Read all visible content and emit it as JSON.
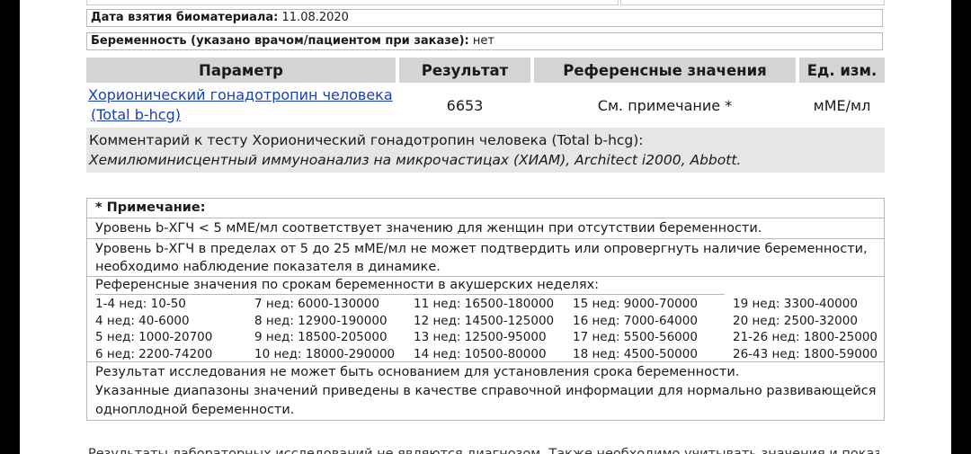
{
  "meta": {
    "sample_date_label": "Дата взятия биоматериала:",
    "sample_date_value": "11.08.2020",
    "pregnancy_label": "Беременность (указано врачом/пациентом при заказе):",
    "pregnancy_value": "нет"
  },
  "results": {
    "headers": [
      "Параметр",
      "Результат",
      "Референсные значения",
      "Ед. изм."
    ],
    "row": {
      "param_line1": "Хорионический гонадотропин человека",
      "param_line2": "(Total b-hcg)",
      "result": "6653",
      "reference": "См. примечание *",
      "unit": "мМЕ/мл"
    },
    "comment_line1": "Комментарий к тесту Хорионический гонадотропин человека (Total b-hcg):",
    "comment_line2": "Хемилюминисцентный иммуноанализ на микрочастицах (ХИАМ), Architect i2000, Abbott."
  },
  "note": {
    "title": "* Примечание:",
    "line1": "Уровень b-ХГЧ < 5 мМЕ/мл соответствует значению для женщин при отсутствии беременности.",
    "line2a": "Уровень b-ХГЧ в пределах от 5 до 25 мМЕ/мл не может подтвердить или опровергнуть наличие беременности,",
    "line2b": "необходимо наблюдение показателя в динамике.",
    "weeks_heading": "Референсные значения по срокам беременности в акушерских неделях:",
    "weeks": [
      "1-4 нед: 10-50",
      "7 нед: 6000-130000",
      "11 нед: 16500-180000",
      "15 нед: 9000-70000",
      "19 нед: 3300-40000",
      "4 нед: 40-6000",
      "8 нед: 12900-190000",
      "12 нед: 14500-125000",
      "16 нед: 7000-64000",
      "20 нед: 2500-32000",
      "5 нед: 1000-20700",
      "9 нед: 18500-205000",
      "13 нед: 12500-95000",
      "17 нед: 5500-56000",
      "21-26 нед: 1800-25000",
      "6 нед: 2200-74200",
      "10 нед: 18000-290000",
      "14 нед: 10500-80000",
      "18 нед: 4500-50000",
      "26-43 нед: 1800-59000"
    ],
    "foot1": "Результат исследования не может быть основанием для установления срока беременности.",
    "foot2": "Указанные диапазоны значений приведены в качестве справочной информации для нормально развивающейся",
    "foot3": "одноплодной беременности."
  },
  "cutoff_text": "Результаты лабораторных исследований не являются диагнозом. Также необходимо учитывать значения и показатели"
}
